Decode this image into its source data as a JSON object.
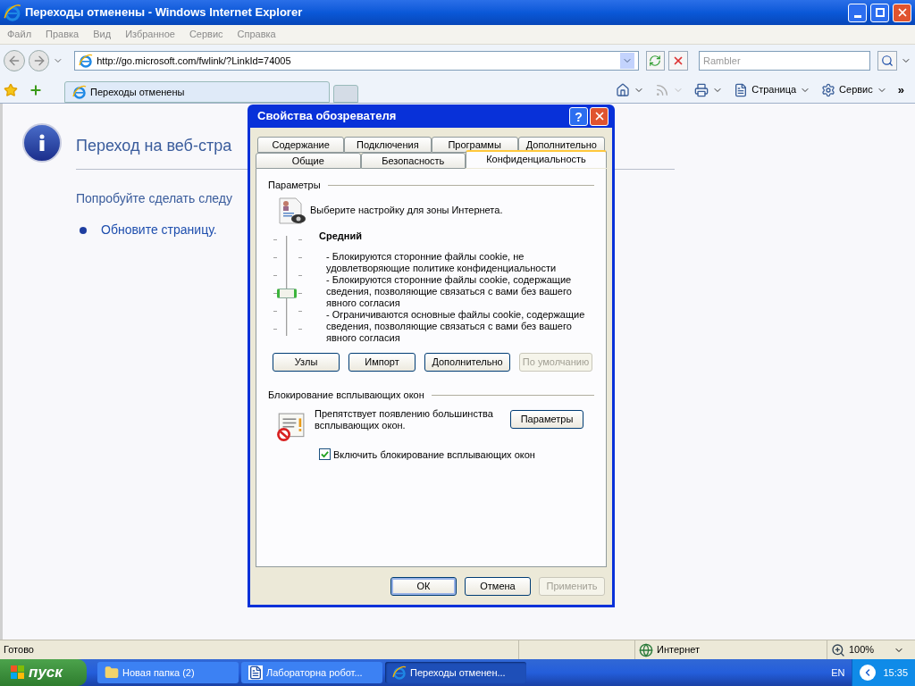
{
  "window": {
    "title": "Переходы отменены - Windows Internet Explorer"
  },
  "menu": [
    "Файл",
    "Правка",
    "Вид",
    "Избранное",
    "Сервис",
    "Справка"
  ],
  "address_bar": {
    "value": "http://go.microsoft.com/fwlink/?LinkId=74005"
  },
  "search": {
    "placeholder": "Rambler"
  },
  "tabs": [
    {
      "label": "Переходы отменены",
      "selected": true
    }
  ],
  "command_bar": [
    {
      "kind": "home",
      "disabled": false
    },
    {
      "kind": "feeds",
      "disabled": true
    },
    {
      "kind": "print",
      "disabled": false
    },
    {
      "kind": "page",
      "label": "Страница",
      "disabled": false
    },
    {
      "kind": "tools",
      "label": "Сервис",
      "disabled": false
    }
  ],
  "command_more": "»",
  "page": {
    "heading": "Переход на веб-стра",
    "instruction": "Попробуйте сделать следу",
    "links": [
      "Обновите страницу."
    ]
  },
  "dialog": {
    "title": "Свойства обозревателя",
    "help": "?",
    "tab_rows": [
      [
        {
          "label": "Содержание",
          "selected": false
        },
        {
          "label": "Подключения",
          "selected": false
        },
        {
          "label": "Программы",
          "selected": false
        },
        {
          "label": "Дополнительно",
          "selected": false
        }
      ],
      [
        {
          "label": "Общие",
          "selected": false
        },
        {
          "label": "Безопасность",
          "selected": false
        },
        {
          "label": "Конфиденциальность",
          "selected": true
        }
      ]
    ],
    "settings_group": "Параметры",
    "zone_prompt": "Выберите настройку для зоны Интернета.",
    "slider": {
      "level": 0.4
    },
    "level_name": "Средний",
    "description": [
      "- Блокируются сторонние файлы cookie, не удовлетворяющие политике конфиденциальности",
      "- Блокируются сторонние файлы cookie, содержащие сведения, позволяющие связаться с вами без вашего явного согласия",
      "- Ограничиваются основные файлы cookie, содержащие сведения, позволяющие связаться с вами без вашего явного согласия"
    ],
    "privacy_buttons": [
      {
        "label": "Узлы",
        "disabled": false
      },
      {
        "label": "Импорт",
        "disabled": false
      },
      {
        "label": "Дополнительно",
        "disabled": false
      },
      {
        "label": "По умолчанию",
        "disabled": true
      }
    ],
    "popup_group": "Блокирование всплывающих окон",
    "popup_text": "Препятствует появлению большинства всплывающих окон.",
    "popup_settings": "Параметры",
    "popup_checkbox": {
      "label": "Включить блокирование всплывающих окон",
      "checked": true
    },
    "footer_buttons": [
      {
        "label": "ОК",
        "disabled": false,
        "default": true
      },
      {
        "label": "Отмена",
        "disabled": false,
        "default": false
      },
      {
        "label": "Применить",
        "disabled": true,
        "default": false
      }
    ]
  },
  "status_bar": {
    "text": "Готово",
    "zone": "Интернет",
    "zoom": "100%"
  },
  "taskbar": {
    "start": "пуск",
    "tasks": [
      {
        "label": "Новая папка (2)",
        "kind": "folder",
        "selected": false
      },
      {
        "label": "Лабораторна робот...",
        "kind": "document",
        "selected": false
      },
      {
        "label": "Переходы отменен...",
        "kind": "browser",
        "selected": true
      }
    ],
    "language": "EN",
    "clock": "15:35"
  }
}
